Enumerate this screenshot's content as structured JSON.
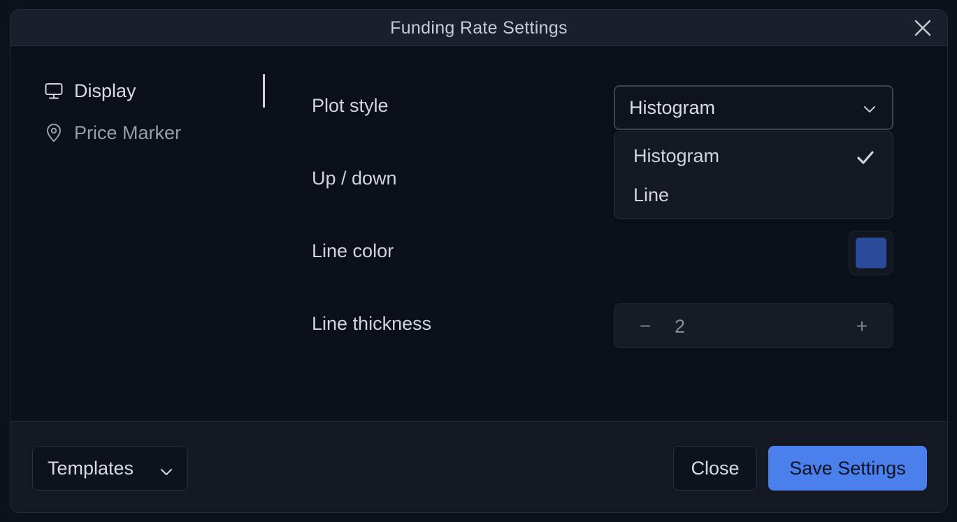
{
  "dialog": {
    "title": "Funding Rate Settings"
  },
  "sidebar": {
    "items": [
      {
        "label": "Display",
        "icon": "monitor-icon",
        "active": true
      },
      {
        "label": "Price Marker",
        "icon": "map-pin-icon",
        "active": false
      }
    ]
  },
  "settings": {
    "plot_style": {
      "label": "Plot style",
      "selected": "Histogram",
      "options": [
        "Histogram",
        "Line"
      ]
    },
    "up_down": {
      "label": "Up / down"
    },
    "line_color": {
      "label": "Line color",
      "color": "#2b4a9a"
    },
    "line_thickness": {
      "label": "Line thickness",
      "value": "2",
      "minus": "−",
      "plus": "+"
    }
  },
  "footer": {
    "templates_label": "Templates",
    "close_label": "Close",
    "save_label": "Save Settings"
  },
  "colors": {
    "accent": "#4a7fec",
    "background": "#0b0f17",
    "header": "#1a1f2b"
  }
}
